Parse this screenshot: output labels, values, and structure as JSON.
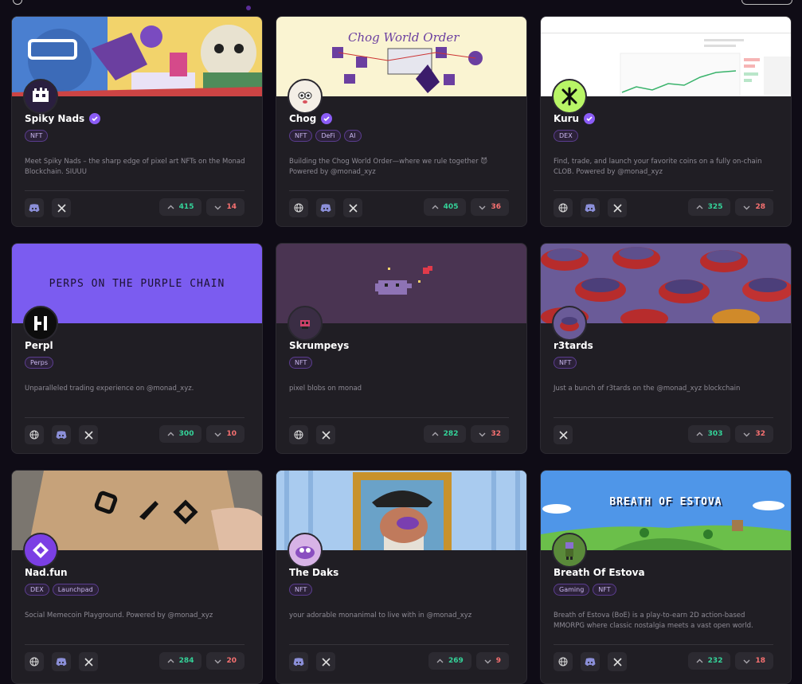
{
  "cards": [
    {
      "name": "Spiky Nads",
      "verified": true,
      "tags": [
        "NFT"
      ],
      "description": "Meet Spiky Nads – the sharp edge of pixel art NFTs on the Monad Blockchain. SIUUU",
      "links": [
        "discord-icon",
        "x-icon"
      ],
      "upvotes": "415",
      "downvotes": "14"
    },
    {
      "name": "Chog",
      "verified": true,
      "tags": [
        "NFT",
        "DeFi",
        "AI"
      ],
      "description": "Building the Chog World Order—where we rule together 😈 Powered by @monad_xyz",
      "links": [
        "globe-icon",
        "discord-icon",
        "x-icon"
      ],
      "upvotes": "405",
      "downvotes": "36",
      "banner_text": "Chog World Order"
    },
    {
      "name": "Kuru",
      "verified": true,
      "tags": [
        "DEX"
      ],
      "description": "Find, trade, and launch your favorite coins on a fully on-chain CLOB. Powered by @monad_xyz",
      "links": [
        "globe-icon",
        "discord-icon",
        "x-icon"
      ],
      "upvotes": "325",
      "downvotes": "28"
    },
    {
      "name": "Perpl",
      "verified": false,
      "tags": [
        "Perps"
      ],
      "description": "Unparalleled trading experience on @monad_xyz.",
      "links": [
        "globe-icon",
        "discord-icon",
        "x-icon"
      ],
      "upvotes": "300",
      "downvotes": "10",
      "banner_text": "PERPS ON THE PURPLE CHAIN"
    },
    {
      "name": "Skrumpeys",
      "verified": false,
      "tags": [
        "NFT"
      ],
      "description": "pixel blobs on monad",
      "links": [
        "globe-icon",
        "x-icon"
      ],
      "upvotes": "282",
      "downvotes": "32"
    },
    {
      "name": "r3tards",
      "verified": false,
      "tags": [
        "NFT"
      ],
      "description": "Just a bunch of r3tards on the @monad_xyz blockchain",
      "links": [
        "x-icon"
      ],
      "upvotes": "303",
      "downvotes": "32"
    },
    {
      "name": "Nad.fun",
      "verified": false,
      "tags": [
        "DEX",
        "Launchpad"
      ],
      "description": "Social Memecoin Playground. Powered by @monad_xyz",
      "links": [
        "globe-icon",
        "discord-icon",
        "x-icon"
      ],
      "upvotes": "284",
      "downvotes": "20"
    },
    {
      "name": "The Daks",
      "verified": false,
      "tags": [
        "NFT"
      ],
      "description": "your adorable monanimal to live with in @monad_xyz",
      "links": [
        "discord-icon",
        "x-icon"
      ],
      "upvotes": "269",
      "downvotes": "9"
    },
    {
      "name": "Breath Of Estova",
      "verified": false,
      "tags": [
        "Gaming",
        "NFT"
      ],
      "description": "Breath of Estova (BoE) is a play-to-earn 2D action-based MMORPG where classic nostalgia meets a vast open world.",
      "links": [
        "globe-icon",
        "discord-icon",
        "x-icon"
      ],
      "upvotes": "232",
      "downvotes": "18",
      "banner_text": "BREATH OF ESTOVA"
    }
  ],
  "colors": {
    "accent": "#8b5cf6",
    "up": "#34d399",
    "down": "#f87171",
    "card_bg": "#201e24"
  }
}
